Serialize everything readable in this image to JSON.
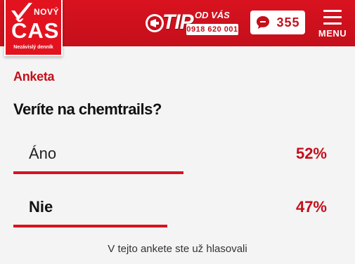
{
  "header": {
    "logo": {
      "top_word": "NOVÝ",
      "main_word": "ČAS",
      "tagline": "Nezávislý denník"
    },
    "tip": {
      "word": "TIP",
      "suffix": "OD VÁS",
      "phone": "0918 620 001",
      "icon": "megaphone-badge-icon"
    },
    "comments": {
      "count": "355",
      "icon": "comment-bubble-icon"
    },
    "menu": {
      "label": "MENU",
      "icon": "hamburger-icon"
    }
  },
  "poll": {
    "section_label": "Anketa",
    "question": "Veríte na chemtrails?",
    "options": [
      {
        "label": "Áno",
        "percent": "52%",
        "fraction": 0.52,
        "selected": false
      },
      {
        "label": "Nie",
        "percent": "47%",
        "fraction": 0.47,
        "selected": true
      }
    ],
    "footer_note": "V tejto ankete ste už hlasovali"
  },
  "colors": {
    "brand_red": "#d9121f",
    "text_dark": "#111111",
    "background": "#f4f4f4"
  }
}
